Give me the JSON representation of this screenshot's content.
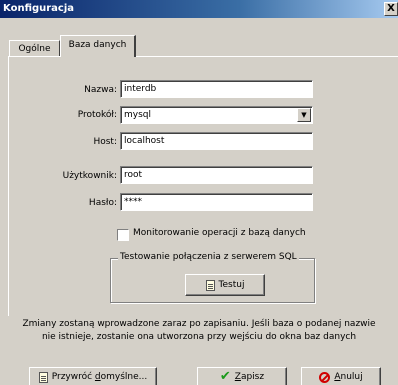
{
  "window": {
    "title": "Konfiguracja",
    "close_glyph": "X"
  },
  "tabs": [
    {
      "label": "Ogólne",
      "active": false
    },
    {
      "label": "Baza danych",
      "active": true
    }
  ],
  "form": {
    "name_label": "Nazwa:",
    "name_value": "interdb",
    "protocol_label": "Protokół:",
    "protocol_value": "mysql",
    "host_label": "Host:",
    "host_value": "localhost",
    "user_label": "Użytkownik:",
    "user_value": "root",
    "password_label": "Hasło:",
    "password_value": "****",
    "monitor_label": "Monitorowanie operacji z bazą danych",
    "monitor_checked": false
  },
  "test_group": {
    "label": "Testowanie połączenia z serwerem SQL",
    "button_label": "Testuj"
  },
  "info": {
    "line1": "Zmiany zostaną wprowadzone zaraz po zapisaniu. Jeśli baza o podanej nazwie",
    "line2": "nie istnieje, zostanie ona utworzona przy wejściu do okna baz danych"
  },
  "buttons": {
    "restore_pre": "Przywróć ",
    "restore_ul": "d",
    "restore_post": "omyślne...",
    "save_pre": "",
    "save_ul": "Z",
    "save_post": "apisz",
    "cancel_pre": "",
    "cancel_ul": "A",
    "cancel_post": "nuluj"
  },
  "icons": {
    "test": "document-icon",
    "restore": "document-icon",
    "save": "checkmark-icon",
    "cancel": "no-entry-icon",
    "dropdown": "chevron-down-icon"
  },
  "colors": {
    "titlebar_start": "#0a246a",
    "titlebar_end": "#a6caf0",
    "face": "#d4d0c8",
    "check_green": "#1a9a1a",
    "cancel_red": "#d00000"
  }
}
